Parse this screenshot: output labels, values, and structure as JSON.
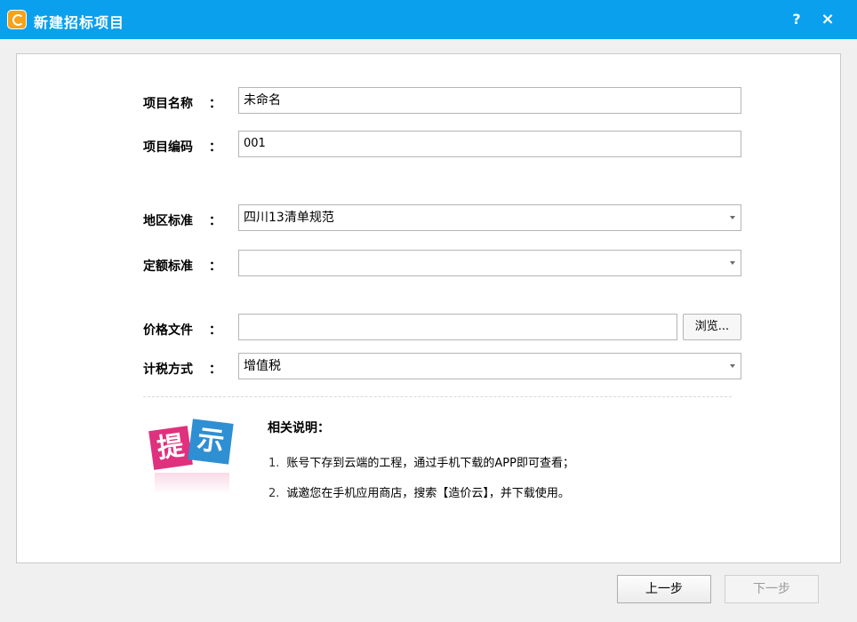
{
  "window": {
    "title": "新建招标项目",
    "help_label": "?",
    "close_label": "×",
    "accent_color": "#0aa0ee"
  },
  "form": {
    "project_name": {
      "label": "项目名称",
      "colon": "：",
      "value": "未命名"
    },
    "project_code": {
      "label": "项目编码",
      "colon": "：",
      "value": "001"
    },
    "region_standard": {
      "label": "地区标准",
      "colon": "：",
      "value": "四川13清单规范"
    },
    "quota_standard": {
      "label": "定额标准",
      "colon": "：",
      "value": ""
    },
    "price_file": {
      "label": "价格文件",
      "colon": "：",
      "value": "",
      "browse_label": "浏览..."
    },
    "tax_method": {
      "label": "计税方式",
      "colon": "：",
      "value": "增值税"
    }
  },
  "tip": {
    "badge_chars": [
      "提",
      "示"
    ],
    "title": "相关说明：",
    "notes": [
      {
        "num": "1.",
        "text": "账号下存到云端的工程，通过手机下载的APP即可查看；"
      },
      {
        "num": "2.",
        "text": "诚邀您在手机应用商店，搜索【造价云】，并下载使用。"
      }
    ]
  },
  "footer": {
    "prev_label": "上一步",
    "next_label": "下一步"
  }
}
